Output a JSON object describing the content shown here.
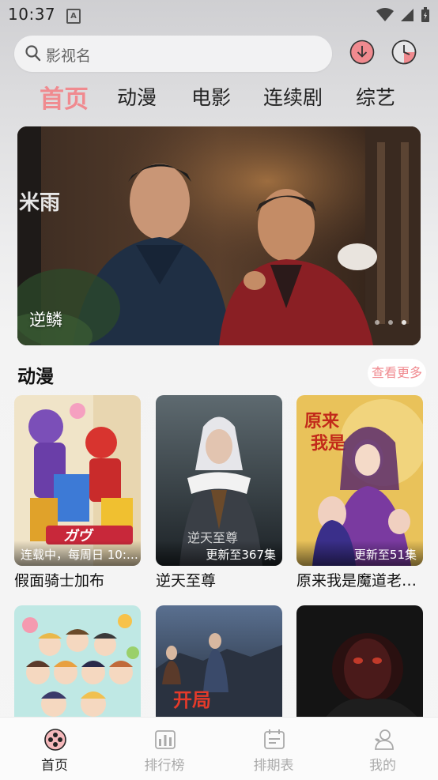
{
  "status_bar": {
    "time": "10:37",
    "notification_icon": "A"
  },
  "search": {
    "placeholder": "影视名"
  },
  "header_buttons": {
    "download_icon": "download-icon",
    "history_icon": "history-icon"
  },
  "category_tabs": [
    {
      "label": "首页",
      "active": true
    },
    {
      "label": "动漫",
      "active": false
    },
    {
      "label": "电影",
      "active": false
    },
    {
      "label": "连续剧",
      "active": false
    },
    {
      "label": "综艺",
      "active": false
    }
  ],
  "banner": {
    "title": "逆鳞",
    "poster_text": "米雨",
    "page_count": 3
  },
  "section": {
    "title": "动漫",
    "more_label": "查看更多",
    "items": [
      {
        "name": "假面骑士加布",
        "badge": "连载中，每周日 10:…"
      },
      {
        "name": "逆天至尊",
        "badge": "更新至367集"
      },
      {
        "name": "原来我是魔道老…",
        "badge": "更新至51集"
      }
    ],
    "row2_posters": [
      {
        "overlay": ""
      },
      {
        "overlay": "开局"
      },
      {
        "overlay": ""
      }
    ]
  },
  "bottom_nav": [
    {
      "label": "首页",
      "icon": "home-icon",
      "active": true
    },
    {
      "label": "排行榜",
      "icon": "ranking-icon",
      "active": false
    },
    {
      "label": "排期表",
      "icon": "schedule-icon",
      "active": false
    },
    {
      "label": "我的",
      "icon": "profile-icon",
      "active": false
    }
  ],
  "colors": {
    "accent": "#f08a8f",
    "background": "#f5f5f5"
  }
}
